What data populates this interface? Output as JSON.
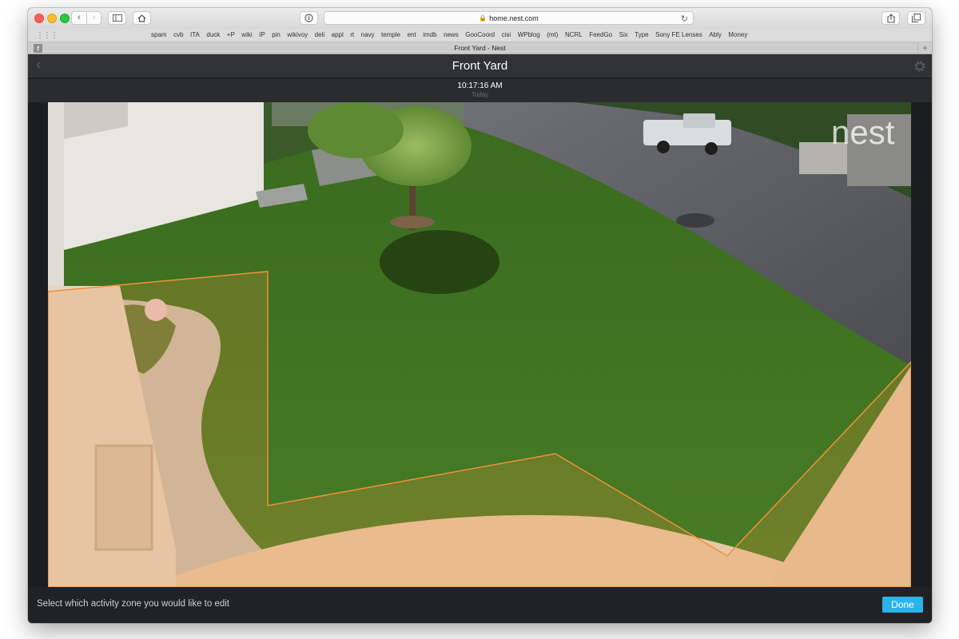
{
  "browser": {
    "url": "home.nest.com",
    "tab_title": "Front Yard - Nest",
    "bookmarks": [
      "spam",
      "cvb",
      "ITA",
      "duck",
      "+P",
      "wiki",
      "IP",
      "pin",
      "wikivoy",
      "deli",
      "appl",
      "rt",
      "navy",
      "temple",
      "ent",
      "imdb",
      "news",
      "GooCoord",
      "cisi",
      "WPblog",
      "(mt)",
      "NCRL",
      "FeedGo",
      "Six",
      "Type",
      "Sony FE Lenses",
      "Ably",
      "Money"
    ],
    "icons": {
      "back": "chevron-left-icon",
      "forward": "chevron-right-icon",
      "sidebar": "sidebar-icon",
      "home": "home-icon",
      "reader": "info-icon",
      "lock": "lock-icon",
      "reload": "reload-icon",
      "share": "share-icon",
      "tabs": "tabs-icon",
      "favicon": "facebook-icon",
      "new_tab": "plus-icon"
    },
    "favicon_letter": "f"
  },
  "camera": {
    "title": "Front Yard",
    "time": "10:17:16 AM",
    "day": "Today",
    "watermark": "nest",
    "zone_color": "#f0913a"
  },
  "footer": {
    "hint": "Select which activity zone you would like to edit",
    "done_label": "Done",
    "done_color": "#2bb3ea"
  }
}
